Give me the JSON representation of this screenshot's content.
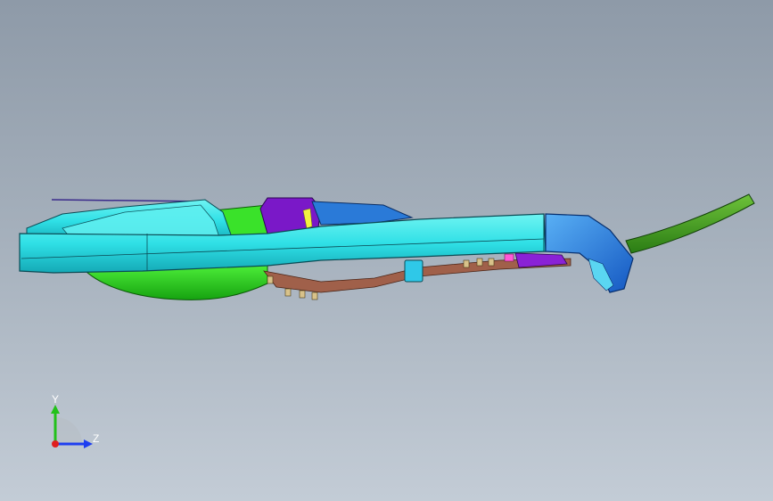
{
  "viewport": {
    "background_top": "#8e9aa8",
    "background_bottom": "#c3ccd6"
  },
  "model": {
    "colors": {
      "cyan_body": "#2fe0e6",
      "cyan_dark": "#16b9c4",
      "green_part": "#2ad81a",
      "green_dark": "#1a9a12",
      "purple_part": "#7a18c8",
      "blue_end": "#1f6fd6",
      "brown_bracket": "#a0604a",
      "olive_rod": "#3d9a1e",
      "pink_detail": "#ff59d8",
      "yellow_detail": "#f2f240",
      "edge_color": "#0b4b55"
    }
  },
  "triad": {
    "y_label": "Y",
    "z_label": "Z",
    "y_color": "#22c11a",
    "z_color": "#1e3ef0",
    "origin_color": "#e01e1e"
  }
}
